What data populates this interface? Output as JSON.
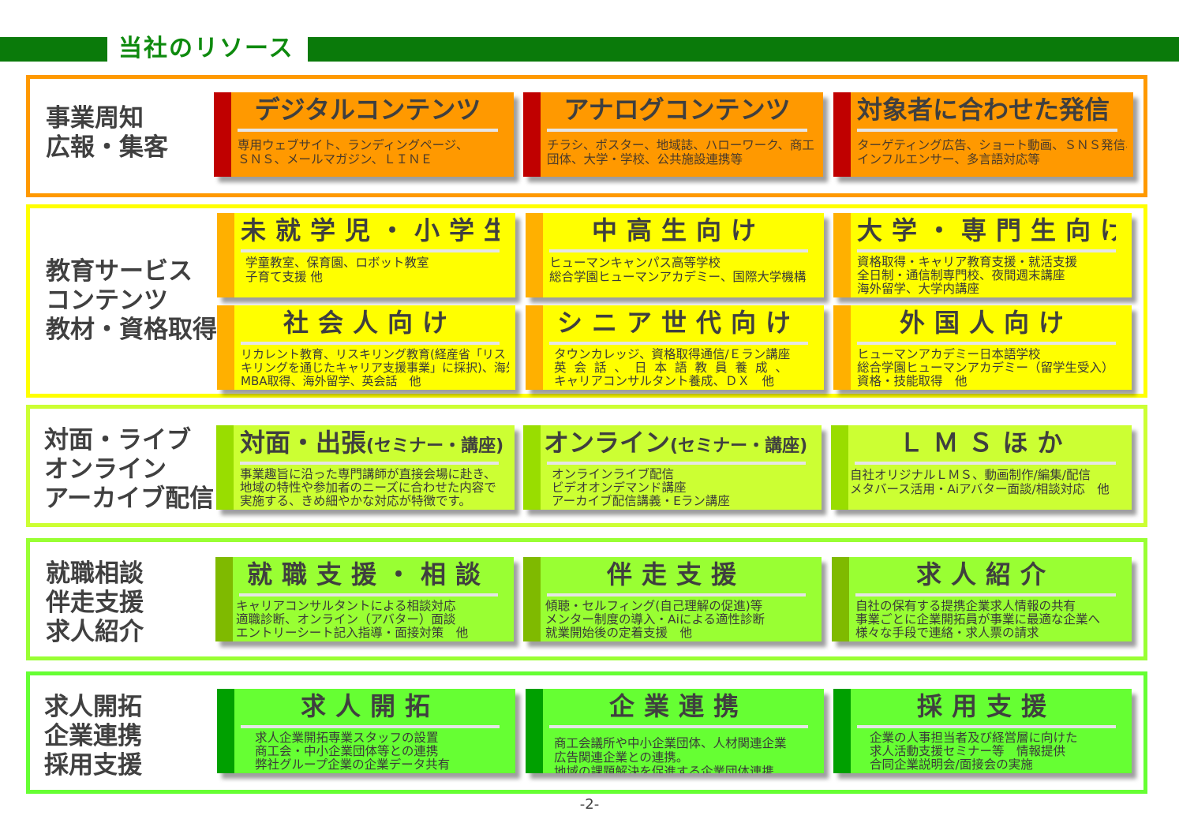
{
  "header": {
    "title": "当社のリソース"
  },
  "colors": {
    "header_bar": "#0a7a0a",
    "title_text": "#0e8a0e"
  },
  "sections": [
    {
      "label": [
        "事業周知",
        "広報・集客"
      ],
      "border_color": "#ff9900",
      "cards": [
        {
          "title": "デジタルコンテンツ",
          "desc": [
            "専用ウェブサイト、ランディングページ、",
            "ＳＮＳ、メールマガジン、ＬＩＮＥ"
          ]
        },
        {
          "title": "アナログコンテンツ",
          "desc": [
            "チラシ、ポスター、地域誌、ハローワーク、商工",
            "団体、大学・学校、公共施設連携等"
          ]
        },
        {
          "title": "対象者に合わせた発信",
          "desc": [
            "ターゲティング広告、ショート動画、ＳＮＳ発信、",
            "インフルエンサー、多言語対応等"
          ]
        }
      ]
    },
    {
      "label": [
        "教育サービス",
        "コンテンツ",
        "教材・資格取得"
      ],
      "border_color": "#ffff00",
      "cards": [
        {
          "title": "未就学児・小学生",
          "desc": [
            "学童教室、保育園、ロボット教室",
            "子育て支援 他"
          ]
        },
        {
          "title": "中高生向け",
          "desc": [
            "ヒューマンキャンパス高等学校",
            "総合学園ヒューマンアカデミー、国際大学機構"
          ]
        },
        {
          "title": "大学・専門生向け",
          "desc": [
            "資格取得・キャリア教育支援・就活支援",
            "全日制・通信制専門校、夜間週末講座",
            "海外留学、大学内講座"
          ]
        },
        {
          "title": "社会人向け",
          "desc": [
            "リカレント教育、リスキリング教育(経産省「リス",
            "キリングを通じたキャリア支援事業」に採択)、海外",
            "MBA取得、海外留学、英会話　他"
          ]
        },
        {
          "title": "シニア世代向け",
          "desc": [
            "タウンカレッジ、資格取得通信/Ｅラン講座",
            "英会話、日本語教員養成、",
            "キャリアコンサルタント養成、ＤＸ　他"
          ]
        },
        {
          "title": "外国人向け",
          "desc": [
            "ヒューマンアカデミー日本語学校",
            "総合学園ヒューマンアカデミー（留学生受入）",
            "資格・技能取得　他"
          ]
        }
      ]
    },
    {
      "label": [
        "対面・ライブ",
        "オンライン",
        "アーカイブ配信"
      ],
      "border_color": "#ccff33",
      "cards": [
        {
          "title": "対面・出張",
          "title_sub": "(セミナー・講座)",
          "desc": [
            "事業趣旨に沿った専門講師が直接会場に赴き、",
            "地域の特性や参加者のニーズに合わせた内容で",
            "実施する、きめ細やかな対応が特徴です。"
          ]
        },
        {
          "title": "オンライン",
          "title_sub": "(セミナー・講座)",
          "desc": [
            "オンラインライブ配信",
            "ビデオオンデマンド講座",
            "アーカイブ配信講義・Eラン講座"
          ]
        },
        {
          "title": "ＬＭＳほか",
          "desc": [
            "自社オリジナルＬＭＳ、動画制作/編集/配信",
            "メタバース活用・Aiアバター面談/相談対応　他"
          ]
        }
      ]
    },
    {
      "label": [
        "就職相談",
        "伴走支援",
        "求人紹介"
      ],
      "border_color": "#99ff33",
      "cards": [
        {
          "title": "就職支援・相談",
          "desc": [
            "キャリアコンサルタントによる相談対応",
            "適職診断、オンライン（アバター）面談",
            "エントリーシート記入指導・面接対策　他"
          ]
        },
        {
          "title": "伴走支援",
          "desc": [
            "傾聴・セルフィング(自己理解の促進)等",
            "メンター制度の導入・Aiによる適性診断",
            "就業開始後の定着支援　他"
          ]
        },
        {
          "title": "求人紹介",
          "desc": [
            "自社の保有する提携企業求人情報の共有",
            "事業ごとに企業開拓員が事業に最適な企業へ",
            "様々な手段で連絡・求人票の請求"
          ]
        }
      ]
    },
    {
      "label": [
        "求人開拓",
        "企業連携",
        "採用支援"
      ],
      "border_color": "#66ff33",
      "cards": [
        {
          "title": "求人開拓",
          "desc": [
            "求人企業開拓専業スタッフの設置",
            "商工会・中小企業団体等との連携",
            "弊社グループ企業の企業データ共有"
          ]
        },
        {
          "title": "企業連携",
          "desc": [
            "商工会議所や中小企業団体、人材関連企業",
            "広告関連企業との連携。",
            "地域の課題解決を促進する企業団体連携"
          ]
        },
        {
          "title": "採用支援",
          "desc": [
            "企業の人事担当者及び経営層に向けた",
            "求人活動支援セミナー等　情報提供",
            "合同企業説明会/面接会の実施"
          ]
        }
      ]
    }
  ],
  "page_number": "-2-"
}
